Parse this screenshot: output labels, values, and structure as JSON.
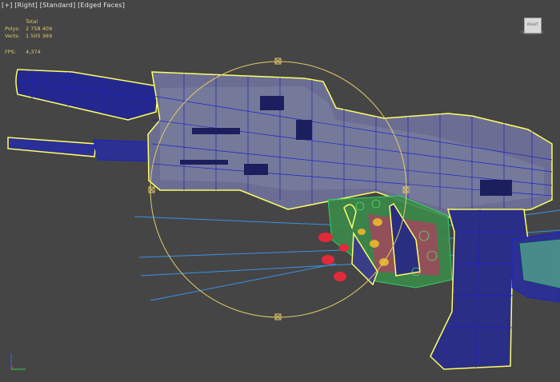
{
  "viewport": {
    "label_parts": [
      "[+]",
      "[Right]",
      "[Standard]",
      "[Edged Faces]"
    ]
  },
  "stats": {
    "header": "Total",
    "polys_label": "Polys:",
    "polys_value": "2 758 409",
    "verts_label": "Verts:",
    "verts_value": "1 505 369",
    "fps_label": "FPS:",
    "fps_value": "4,374"
  },
  "viewcube": {
    "face_label": "RIGHT"
  },
  "colors": {
    "viewport_bg": "#454545",
    "stats_text": "#e3c76a",
    "selection_outline": "#ffff66",
    "wire_blue": "#1a22c8",
    "gizmo_circle": "#e2c96b",
    "light_rays": "#3aa0ff"
  },
  "icons": {
    "viewcube": "viewcube-icon",
    "axis": "axis-tripod-icon",
    "gizmo_handle": "gizmo-handle-icon"
  }
}
